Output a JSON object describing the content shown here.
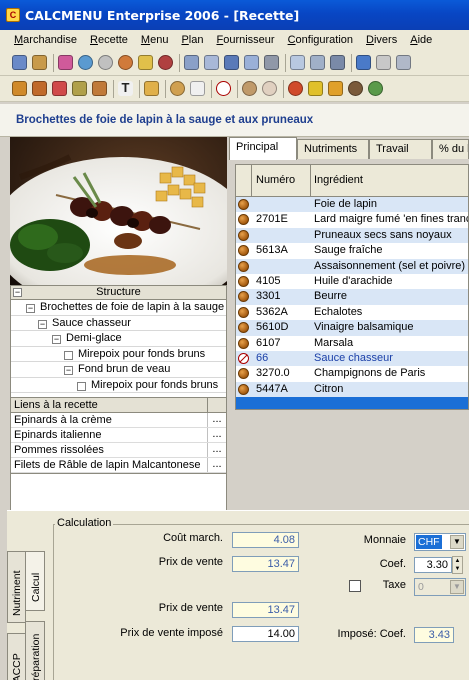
{
  "window": {
    "title": "CALCMENU Enterprise 2006 - [Recette]",
    "app_icon_glyph": "C"
  },
  "menu": [
    "Marchandise",
    "Recette",
    "Menu",
    "Plan",
    "Fournisseur",
    "Configuration",
    "Divers",
    "Aide"
  ],
  "recipe": {
    "title": "Brochettes de foie de lapin à la sauge et aux pruneaux"
  },
  "structure": {
    "header": "Structure",
    "items": [
      {
        "label": "Brochettes de foie de lapin à la sauge et",
        "box": "−",
        "level": 1
      },
      {
        "label": "Sauce chasseur",
        "box": "−",
        "level": 2
      },
      {
        "label": "Demi-glace",
        "box": "−",
        "level": 3
      },
      {
        "label": "Mirepoix pour fonds bruns",
        "box": "",
        "level": 4
      },
      {
        "label": "Fond brun de veau",
        "box": "−",
        "level": 4
      },
      {
        "label": "Mirepoix pour fonds bruns",
        "box": "",
        "level": 5
      }
    ]
  },
  "liens": {
    "header": "Liens à la recette",
    "items": [
      "Epinards à la crème",
      "Epinards italienne",
      "Pommes rissolées",
      "Filets de Râble de lapin Malcantonese"
    ],
    "more_label": "..."
  },
  "tabs": [
    "Principal",
    "Nutriments",
    "Travail",
    "% du b"
  ],
  "ingredients": {
    "col_number": "Numéro",
    "col_name": "Ingrédient",
    "rows": [
      {
        "num": "",
        "name": "Foie de lapin",
        "type": "item"
      },
      {
        "num": "2701E",
        "name": "Lard maigre fumé 'en fines tranches'",
        "type": "item"
      },
      {
        "num": "",
        "name": "Pruneaux secs sans noyaux",
        "type": "item"
      },
      {
        "num": "5613A",
        "name": "Sauge fraîche",
        "type": "item"
      },
      {
        "num": "",
        "name": "Assaisonnement (sel et poivre)",
        "type": "item"
      },
      {
        "num": "4105",
        "name": "Huile d'arachide",
        "type": "item"
      },
      {
        "num": "3301",
        "name": "Beurre",
        "type": "item"
      },
      {
        "num": "5362A",
        "name": "Echalotes",
        "type": "item"
      },
      {
        "num": "5610D",
        "name": "Vinaigre balsamique",
        "type": "item"
      },
      {
        "num": "6107",
        "name": "Marsala",
        "type": "item"
      },
      {
        "num": "66",
        "name": "Sauce chasseur",
        "type": "subrecipe"
      },
      {
        "num": "3270.0",
        "name": "Champignons de Paris",
        "type": "item"
      },
      {
        "num": "5447A",
        "name": "Citron",
        "type": "item"
      }
    ]
  },
  "side_tabs": [
    "Calcul",
    "Nutriment",
    "Préparation",
    "HACCP"
  ],
  "calculation": {
    "title": "Calculation",
    "cout_march_label": "Coût march.",
    "cout_march": "4.08",
    "prix_vente_label": "Prix de vente",
    "prix_vente": "13.47",
    "prix_vente2_label": "Prix de vente",
    "prix_vente2": "13.47",
    "prix_impose_label": "Prix de vente imposé",
    "prix_impose": "14.00",
    "monnaie_label": "Monnaie",
    "monnaie": "CHF",
    "coef_label": "Coef.",
    "coef": "3.30",
    "taxe_label": "Taxe",
    "taxe": "0",
    "impose_coef_label": "Imposé: Coef.",
    "impose_coef": "3.43"
  },
  "colors": {
    "title_blue": "#0a4fd0",
    "recipe_title": "#1f3f8f",
    "selection_blue": "#1b6fd6",
    "row_highlight": "#d9e6f6",
    "link_blue": "#1a3fa8",
    "field_yellow": "#fefce0"
  }
}
